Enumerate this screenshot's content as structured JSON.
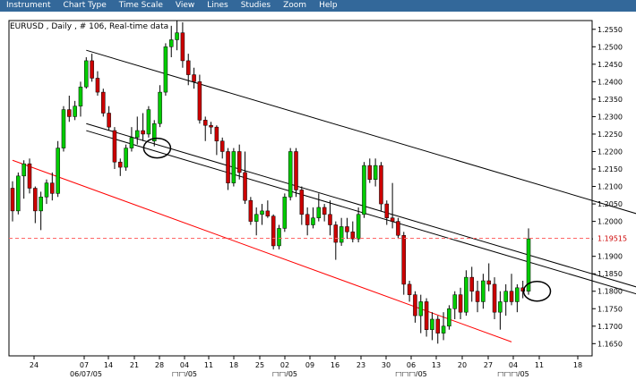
{
  "menu": [
    "Instrument",
    "Chart Type",
    "Time Scale",
    "View",
    "Lines",
    "Studies",
    "Zoom",
    "Help"
  ],
  "chart_title": "EURUSD , Daily , # 106, Real-time data",
  "chart_data": {
    "type": "candlestick",
    "y_ticks": [
      "1.2550",
      "1.2500",
      "1.2450",
      "1.2400",
      "1.2350",
      "1.2300",
      "1.2250",
      "1.2200",
      "1.2150",
      "1.2100",
      "1.2050",
      "1.2000",
      "1.1950",
      "1.1900",
      "1.1850",
      "1.1800",
      "1.1750",
      "1.1700",
      "1.1650"
    ],
    "x_day_ticks": [
      "24",
      "07",
      "14",
      "21",
      "28",
      "04",
      "11",
      "18",
      "25",
      "02",
      "09",
      "16",
      "23",
      "30",
      "06",
      "13",
      "20",
      "27",
      "04",
      "11",
      "18"
    ],
    "x_month_labels": [
      "06/07/05",
      "□□/05",
      "□□/05",
      "□□□/05",
      "□□□/05"
    ],
    "current_price": "1.19515",
    "candles": [
      {
        "o": 1.2095,
        "h": 1.2115,
        "l": 1.2,
        "c": 1.203,
        "color": "red"
      },
      {
        "o": 1.203,
        "h": 1.214,
        "l": 1.202,
        "c": 1.213,
        "color": "green"
      },
      {
        "o": 1.213,
        "h": 1.2175,
        "l": 1.2065,
        "c": 1.2165,
        "color": "green"
      },
      {
        "o": 1.2165,
        "h": 1.218,
        "l": 1.208,
        "c": 1.2095,
        "color": "red"
      },
      {
        "o": 1.2095,
        "h": 1.21,
        "l": 1.1995,
        "c": 1.203,
        "color": "red"
      },
      {
        "o": 1.203,
        "h": 1.2085,
        "l": 1.1975,
        "c": 1.207,
        "color": "green"
      },
      {
        "o": 1.207,
        "h": 1.212,
        "l": 1.205,
        "c": 1.211,
        "color": "green"
      },
      {
        "o": 1.211,
        "h": 1.214,
        "l": 1.206,
        "c": 1.208,
        "color": "red"
      },
      {
        "o": 1.208,
        "h": 1.223,
        "l": 1.207,
        "c": 1.221,
        "color": "green"
      },
      {
        "o": 1.221,
        "h": 1.233,
        "l": 1.22,
        "c": 1.232,
        "color": "green"
      },
      {
        "o": 1.232,
        "h": 1.236,
        "l": 1.2285,
        "c": 1.23,
        "color": "red"
      },
      {
        "o": 1.23,
        "h": 1.2345,
        "l": 1.229,
        "c": 1.233,
        "color": "green"
      },
      {
        "o": 1.233,
        "h": 1.24,
        "l": 1.23,
        "c": 1.2385,
        "color": "green"
      },
      {
        "o": 1.2385,
        "h": 1.247,
        "l": 1.238,
        "c": 1.246,
        "color": "green"
      },
      {
        "o": 1.246,
        "h": 1.248,
        "l": 1.24,
        "c": 1.241,
        "color": "red"
      },
      {
        "o": 1.241,
        "h": 1.243,
        "l": 1.236,
        "c": 1.237,
        "color": "red"
      },
      {
        "o": 1.237,
        "h": 1.238,
        "l": 1.23,
        "c": 1.231,
        "color": "red"
      },
      {
        "o": 1.231,
        "h": 1.233,
        "l": 1.226,
        "c": 1.227,
        "color": "red"
      },
      {
        "o": 1.226,
        "h": 1.227,
        "l": 1.215,
        "c": 1.217,
        "color": "red"
      },
      {
        "o": 1.217,
        "h": 1.218,
        "l": 1.213,
        "c": 1.2155,
        "color": "red"
      },
      {
        "o": 1.2155,
        "h": 1.222,
        "l": 1.2145,
        "c": 1.221,
        "color": "green"
      },
      {
        "o": 1.221,
        "h": 1.227,
        "l": 1.22,
        "c": 1.224,
        "color": "green"
      },
      {
        "o": 1.224,
        "h": 1.23,
        "l": 1.222,
        "c": 1.226,
        "color": "green"
      },
      {
        "o": 1.226,
        "h": 1.231,
        "l": 1.223,
        "c": 1.225,
        "color": "red"
      },
      {
        "o": 1.225,
        "h": 1.233,
        "l": 1.224,
        "c": 1.232,
        "color": "green"
      },
      {
        "o": 1.223,
        "h": 1.229,
        "l": 1.2215,
        "c": 1.228,
        "color": "green"
      },
      {
        "o": 1.228,
        "h": 1.239,
        "l": 1.227,
        "c": 1.237,
        "color": "green"
      },
      {
        "o": 1.237,
        "h": 1.251,
        "l": 1.236,
        "c": 1.25,
        "color": "green"
      },
      {
        "o": 1.25,
        "h": 1.256,
        "l": 1.247,
        "c": 1.252,
        "color": "green"
      },
      {
        "o": 1.252,
        "h": 1.2575,
        "l": 1.249,
        "c": 1.254,
        "color": "green"
      },
      {
        "o": 1.254,
        "h": 1.257,
        "l": 1.244,
        "c": 1.246,
        "color": "red"
      },
      {
        "o": 1.246,
        "h": 1.248,
        "l": 1.239,
        "c": 1.242,
        "color": "red"
      },
      {
        "o": 1.242,
        "h": 1.244,
        "l": 1.238,
        "c": 1.24,
        "color": "red"
      },
      {
        "o": 1.24,
        "h": 1.242,
        "l": 1.228,
        "c": 1.229,
        "color": "red"
      },
      {
        "o": 1.229,
        "h": 1.23,
        "l": 1.223,
        "c": 1.2275,
        "color": "red"
      },
      {
        "o": 1.2275,
        "h": 1.2285,
        "l": 1.225,
        "c": 1.227,
        "color": "red"
      },
      {
        "o": 1.227,
        "h": 1.2275,
        "l": 1.219,
        "c": 1.223,
        "color": "red"
      },
      {
        "o": 1.223,
        "h": 1.224,
        "l": 1.218,
        "c": 1.22,
        "color": "red"
      },
      {
        "o": 1.22,
        "h": 1.221,
        "l": 1.209,
        "c": 1.211,
        "color": "red"
      },
      {
        "o": 1.211,
        "h": 1.221,
        "l": 1.21,
        "c": 1.22,
        "color": "green"
      },
      {
        "o": 1.22,
        "h": 1.222,
        "l": 1.212,
        "c": 1.214,
        "color": "red"
      },
      {
        "o": 1.214,
        "h": 1.22,
        "l": 1.205,
        "c": 1.206,
        "color": "red"
      },
      {
        "o": 1.206,
        "h": 1.207,
        "l": 1.199,
        "c": 1.2,
        "color": "red"
      },
      {
        "o": 1.2,
        "h": 1.204,
        "l": 1.196,
        "c": 1.202,
        "color": "green"
      },
      {
        "o": 1.202,
        "h": 1.205,
        "l": 1.199,
        "c": 1.203,
        "color": "green"
      },
      {
        "o": 1.203,
        "h": 1.206,
        "l": 1.201,
        "c": 1.2015,
        "color": "red"
      },
      {
        "o": 1.2015,
        "h": 1.202,
        "l": 1.192,
        "c": 1.193,
        "color": "red"
      },
      {
        "o": 1.193,
        "h": 1.199,
        "l": 1.192,
        "c": 1.198,
        "color": "green"
      },
      {
        "o": 1.198,
        "h": 1.208,
        "l": 1.197,
        "c": 1.207,
        "color": "green"
      },
      {
        "o": 1.207,
        "h": 1.221,
        "l": 1.206,
        "c": 1.22,
        "color": "green"
      },
      {
        "o": 1.22,
        "h": 1.221,
        "l": 1.207,
        "c": 1.209,
        "color": "red"
      },
      {
        "o": 1.209,
        "h": 1.21,
        "l": 1.199,
        "c": 1.202,
        "color": "red"
      },
      {
        "o": 1.202,
        "h": 1.204,
        "l": 1.196,
        "c": 1.199,
        "color": "red"
      },
      {
        "o": 1.199,
        "h": 1.204,
        "l": 1.198,
        "c": 1.201,
        "color": "green"
      },
      {
        "o": 1.201,
        "h": 1.208,
        "l": 1.2,
        "c": 1.204,
        "color": "green"
      },
      {
        "o": 1.204,
        "h": 1.205,
        "l": 1.2,
        "c": 1.202,
        "color": "red"
      },
      {
        "o": 1.202,
        "h": 1.206,
        "l": 1.196,
        "c": 1.199,
        "color": "red"
      },
      {
        "o": 1.199,
        "h": 1.2,
        "l": 1.189,
        "c": 1.194,
        "color": "red"
      },
      {
        "o": 1.194,
        "h": 1.201,
        "l": 1.193,
        "c": 1.1985,
        "color": "green"
      },
      {
        "o": 1.1985,
        "h": 1.201,
        "l": 1.195,
        "c": 1.197,
        "color": "red"
      },
      {
        "o": 1.197,
        "h": 1.2,
        "l": 1.194,
        "c": 1.195,
        "color": "red"
      },
      {
        "o": 1.195,
        "h": 1.204,
        "l": 1.194,
        "c": 1.202,
        "color": "green"
      },
      {
        "o": 1.202,
        "h": 1.217,
        "l": 1.201,
        "c": 1.216,
        "color": "green"
      },
      {
        "o": 1.216,
        "h": 1.218,
        "l": 1.211,
        "c": 1.212,
        "color": "red"
      },
      {
        "o": 1.212,
        "h": 1.218,
        "l": 1.21,
        "c": 1.216,
        "color": "green"
      },
      {
        "o": 1.216,
        "h": 1.217,
        "l": 1.203,
        "c": 1.205,
        "color": "red"
      },
      {
        "o": 1.205,
        "h": 1.206,
        "l": 1.199,
        "c": 1.201,
        "color": "red"
      },
      {
        "o": 1.201,
        "h": 1.211,
        "l": 1.198,
        "c": 1.2,
        "color": "red"
      },
      {
        "o": 1.2,
        "h": 1.201,
        "l": 1.195,
        "c": 1.196,
        "color": "red"
      },
      {
        "o": 1.196,
        "h": 1.197,
        "l": 1.179,
        "c": 1.182,
        "color": "red"
      },
      {
        "o": 1.182,
        "h": 1.183,
        "l": 1.177,
        "c": 1.179,
        "color": "red"
      },
      {
        "o": 1.179,
        "h": 1.18,
        "l": 1.171,
        "c": 1.173,
        "color": "red"
      },
      {
        "o": 1.173,
        "h": 1.179,
        "l": 1.168,
        "c": 1.177,
        "color": "green"
      },
      {
        "o": 1.177,
        "h": 1.178,
        "l": 1.167,
        "c": 1.169,
        "color": "red"
      },
      {
        "o": 1.169,
        "h": 1.174,
        "l": 1.166,
        "c": 1.172,
        "color": "green"
      },
      {
        "o": 1.172,
        "h": 1.173,
        "l": 1.165,
        "c": 1.168,
        "color": "red"
      },
      {
        "o": 1.168,
        "h": 1.174,
        "l": 1.166,
        "c": 1.17,
        "color": "green"
      },
      {
        "o": 1.17,
        "h": 1.176,
        "l": 1.169,
        "c": 1.175,
        "color": "green"
      },
      {
        "o": 1.175,
        "h": 1.18,
        "l": 1.172,
        "c": 1.179,
        "color": "green"
      },
      {
        "o": 1.179,
        "h": 1.181,
        "l": 1.172,
        "c": 1.174,
        "color": "red"
      },
      {
        "o": 1.174,
        "h": 1.186,
        "l": 1.173,
        "c": 1.184,
        "color": "green"
      },
      {
        "o": 1.184,
        "h": 1.187,
        "l": 1.177,
        "c": 1.18,
        "color": "red"
      },
      {
        "o": 1.18,
        "h": 1.183,
        "l": 1.174,
        "c": 1.177,
        "color": "red"
      },
      {
        "o": 1.177,
        "h": 1.185,
        "l": 1.175,
        "c": 1.183,
        "color": "green"
      },
      {
        "o": 1.183,
        "h": 1.188,
        "l": 1.18,
        "c": 1.182,
        "color": "red"
      },
      {
        "o": 1.182,
        "h": 1.184,
        "l": 1.172,
        "c": 1.174,
        "color": "red"
      },
      {
        "o": 1.174,
        "h": 1.18,
        "l": 1.169,
        "c": 1.177,
        "color": "green"
      },
      {
        "o": 1.177,
        "h": 1.182,
        "l": 1.173,
        "c": 1.18,
        "color": "green"
      },
      {
        "o": 1.18,
        "h": 1.185,
        "l": 1.176,
        "c": 1.177,
        "color": "red"
      },
      {
        "o": 1.177,
        "h": 1.182,
        "l": 1.174,
        "c": 1.181,
        "color": "green"
      },
      {
        "o": 1.181,
        "h": 1.183,
        "l": 1.178,
        "c": 1.18,
        "color": "red"
      },
      {
        "o": 1.18,
        "h": 1.198,
        "l": 1.179,
        "c": 1.195,
        "color": "green"
      }
    ],
    "trendlines": [
      {
        "from": [
          13,
          1.249
        ],
        "to": [
          125,
          1.195
        ],
        "color": "black"
      },
      {
        "from": [
          13,
          1.228
        ],
        "to": [
          125,
          1.174
        ],
        "color": "black"
      },
      {
        "from": [
          13,
          1.226
        ],
        "to": [
          125,
          1.172
        ],
        "color": "black"
      },
      {
        "from": [
          0,
          1.2175
        ],
        "to": [
          88,
          1.1655
        ],
        "color": "red"
      }
    ],
    "circles": [
      {
        "x": 25.5,
        "y": 1.221
      },
      {
        "x": 92.5,
        "y": 1.18
      }
    ],
    "colors": {
      "up": "#00cc00",
      "down": "#cc0000",
      "price_line": "#ff6666",
      "menubar": "#33689a"
    }
  }
}
